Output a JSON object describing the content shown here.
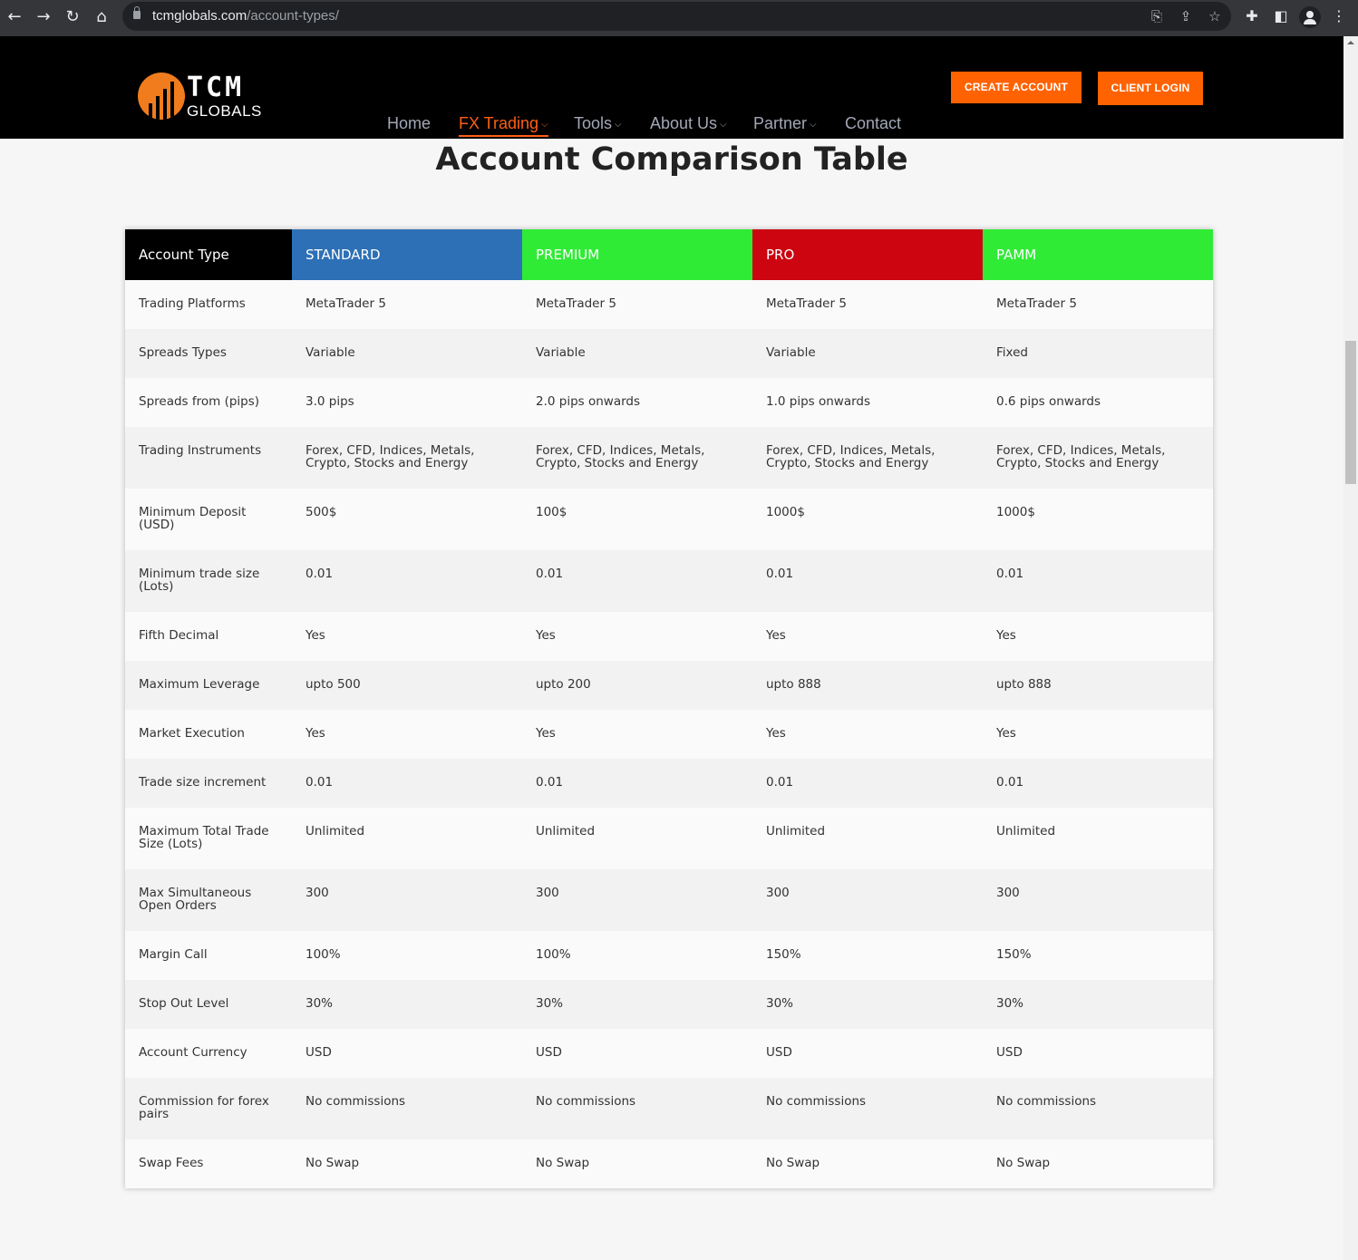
{
  "browser": {
    "url_host": "tcmglobals.com",
    "url_path": "/account-types/",
    "icons": [
      "back-icon",
      "forward-icon",
      "reload-icon",
      "home-icon",
      "lock-icon",
      "translate-icon",
      "share-icon",
      "bookmark-star-icon",
      "extensions-icon",
      "side-panel-icon",
      "profile-icon",
      "menu-icon"
    ]
  },
  "header": {
    "logo_word": "TCM",
    "logo_sub": "GLOBALS",
    "nav": [
      {
        "label": "Home",
        "dropdown": false,
        "active": false
      },
      {
        "label": "FX Trading",
        "dropdown": true,
        "active": true
      },
      {
        "label": "Tools",
        "dropdown": true,
        "active": false
      },
      {
        "label": "About Us",
        "dropdown": true,
        "active": false
      },
      {
        "label": "Partner",
        "dropdown": true,
        "active": false
      },
      {
        "label": "Contact",
        "dropdown": false,
        "active": false
      }
    ],
    "chevron": "⌵",
    "create_account": "CREATE ACCOUNT",
    "client_login": "CLIENT LOGIN",
    "accent_color": "#ff6200"
  },
  "main": {
    "title": "Account Comparison Table",
    "table": {
      "columns": [
        {
          "label": "Account Type",
          "color": "#000000"
        },
        {
          "label": "STANDARD",
          "color": "#2d70b6"
        },
        {
          "label": "PREMIUM",
          "color": "#30eb36"
        },
        {
          "label": "PRO",
          "color": "#cc0510"
        },
        {
          "label": "PAMM",
          "color": "#30eb36"
        }
      ],
      "rows": [
        [
          "Trading Platforms",
          "MetaTrader 5",
          "MetaTrader 5",
          "MetaTrader 5",
          "MetaTrader 5"
        ],
        [
          "Spreads Types",
          "Variable",
          "Variable",
          "Variable",
          "Fixed"
        ],
        [
          "Spreads from (pips)",
          "3.0 pips",
          "2.0 pips onwards",
          "1.0 pips onwards",
          "0.6 pips onwards"
        ],
        [
          "Trading Instruments",
          "Forex, CFD, Indices, Metals, Crypto, Stocks and Energy",
          "Forex, CFD, Indices, Metals, Crypto, Stocks and Energy",
          "Forex, CFD, Indices, Metals, Crypto, Stocks and Energy",
          "Forex, CFD, Indices, Metals, Crypto, Stocks and Energy"
        ],
        [
          "Minimum Deposit (USD)",
          "500$",
          "100$",
          "1000$",
          "1000$"
        ],
        [
          "Minimum trade size (Lots)",
          "0.01",
          "0.01",
          "0.01",
          "0.01"
        ],
        [
          "Fifth Decimal",
          "Yes",
          "Yes",
          "Yes",
          "Yes"
        ],
        [
          "Maximum Leverage",
          "upto 500",
          "upto 200",
          "upto 888",
          "upto 888"
        ],
        [
          "Market Execution",
          "Yes",
          "Yes",
          "Yes",
          "Yes"
        ],
        [
          "Trade size increment",
          "0.01",
          "0.01",
          "0.01",
          "0.01"
        ],
        [
          "Maximum Total Trade Size (Lots)",
          "Unlimited",
          "Unlimited",
          "Unlimited",
          "Unlimited"
        ],
        [
          "Max Simultaneous Open Orders",
          "300",
          "300",
          "300",
          "300"
        ],
        [
          "Margin Call",
          "100%",
          "100%",
          "150%",
          "150%"
        ],
        [
          "Stop Out Level",
          "30%",
          "30%",
          "30%",
          "30%"
        ],
        [
          "Account Currency",
          "USD",
          "USD",
          "USD",
          "USD"
        ],
        [
          "Commission for forex pairs",
          "No commissions",
          "No commissions",
          "No commissions",
          "No commissions"
        ],
        [
          "Swap Fees",
          "No Swap",
          "No Swap",
          "No Swap",
          "No Swap"
        ]
      ]
    }
  }
}
